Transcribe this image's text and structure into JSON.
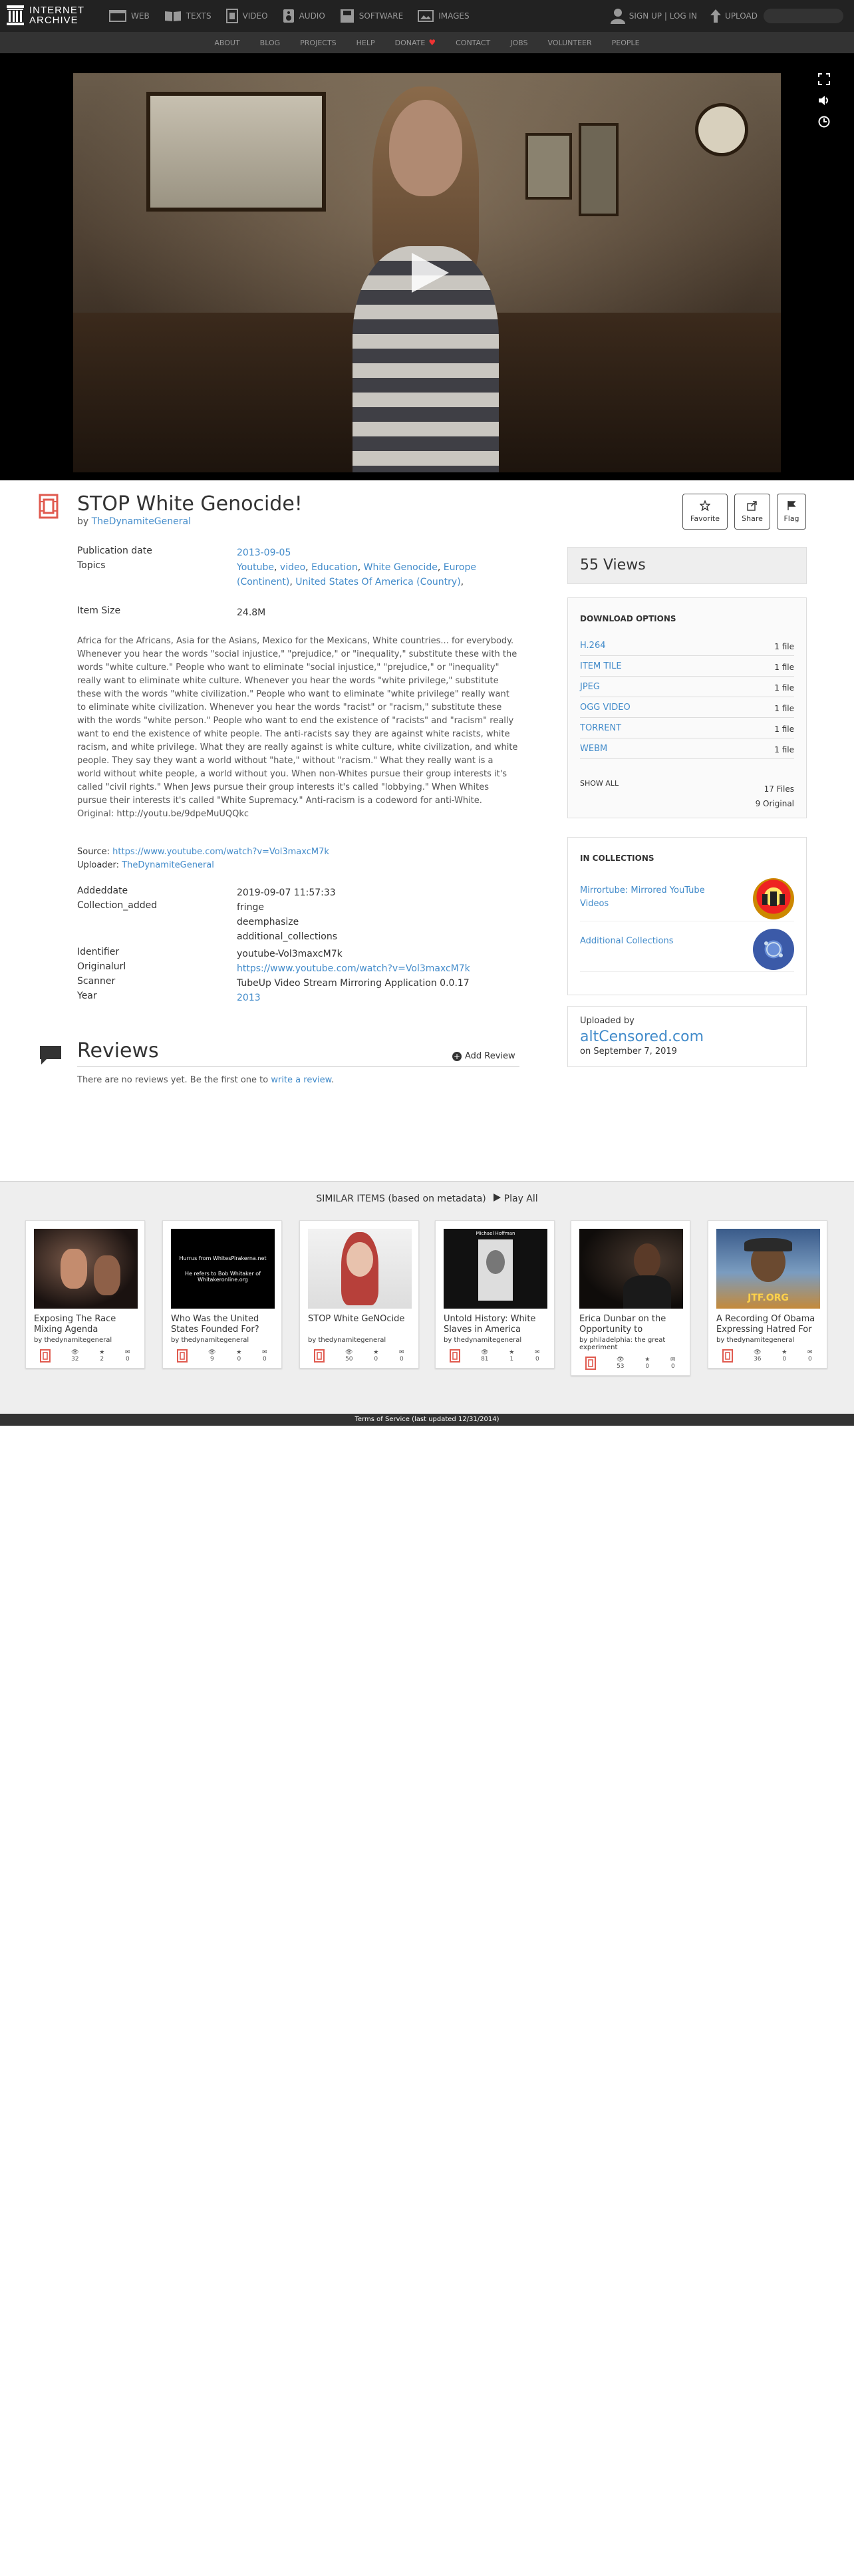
{
  "nav": {
    "logo_line1": "INTERNET",
    "logo_line2": "ARCHIVE",
    "media": [
      {
        "label": "WEB",
        "icon": "web-icon"
      },
      {
        "label": "TEXTS",
        "icon": "texts-icon"
      },
      {
        "label": "VIDEO",
        "icon": "video-icon"
      },
      {
        "label": "AUDIO",
        "icon": "audio-icon"
      },
      {
        "label": "SOFTWARE",
        "icon": "software-icon"
      },
      {
        "label": "IMAGES",
        "icon": "images-icon"
      }
    ],
    "signin": "SIGN UP | LOG IN",
    "upload": "UPLOAD"
  },
  "subnav": {
    "items": [
      "ABOUT",
      "BLOG",
      "PROJECTS",
      "HELP",
      "DONATE",
      "CONTACT",
      "JOBS",
      "VOLUNTEER",
      "PEOPLE"
    ]
  },
  "item": {
    "title": "STOP White Genocide!",
    "by_prefix": "by ",
    "creator": "TheDynamiteGeneral",
    "actions": {
      "favorite": "Favorite",
      "share": "Share",
      "flag": "Flag"
    },
    "pubdate_key": "Publication date",
    "pubdate": "2013-09-05",
    "topics_key": "Topics",
    "topics": [
      "Youtube",
      "video",
      "Education",
      "White Genocide",
      "Europe (Continent)",
      "United States Of America (Country)"
    ],
    "size_key": "Item Size",
    "size": "24.8M",
    "description": "Africa for the Africans, Asia for the Asians, Mexico for the Mexicans, White countries... for everybody. Whenever you hear the words \"social injustice,\" \"prejudice,\" or \"inequality,\" substitute these with the words \"white culture.\" People who want to eliminate \"social injustice,\" \"prejudice,\" or \"inequality\" really want to eliminate white culture. Whenever you hear the words \"white privilege,\" substitute these with the words \"white civilization.\" People who want to eliminate \"white privilege\" really want to eliminate white civilization. Whenever you hear the words \"racist\" or \"racism,\" substitute these with the words \"white person.\" People who want to end the existence of \"racists\" and \"racism\" really want to end the existence of white people. The anti-racists say they are against white racists, white racism, and white privilege. What they are really against is white culture, white civilization, and white people. They say they want a world without \"hate,\" without \"racism.\" What they really want is a world without white people, a world without you. When non-Whites pursue their group interests it's called \"civil rights.\" When Jews pursue their group interests it's called \"lobbying.\" When Whites pursue their interests it's called \"White Supremacy.\" Anti-racism is a codeword for anti-White. Original: http://youtu.be/9dpeMuUQQkc",
    "source_label": "Source: ",
    "source_url": "https://www.youtube.com/watch?v=Vol3maxcM7k",
    "uploader_label": "Uploader: ",
    "uploader": "TheDynamiteGeneral",
    "addeddate_key": "Addeddate",
    "addeddate": "2019-09-07 11:57:33",
    "collection_key": "Collection_added",
    "collections_added": [
      "fringe",
      "deemphasize",
      "additional_collections"
    ],
    "identifier_key": "Identifier",
    "identifier": "youtube-Vol3maxcM7k",
    "originalurl_key": "Originalurl",
    "originalurl": "https://www.youtube.com/watch?v=Vol3maxcM7k",
    "scanner_key": "Scanner",
    "scanner": "TubeUp Video Stream Mirroring Application 0.0.17",
    "year_key": "Year",
    "year": "2013"
  },
  "sidebar": {
    "views": "55 Views",
    "download_heading": "DOWNLOAD OPTIONS",
    "downloads": [
      {
        "format": "H.264",
        "count": "1 file"
      },
      {
        "format": "ITEM TILE",
        "count": "1 file"
      },
      {
        "format": "JPEG",
        "count": "1 file"
      },
      {
        "format": "OGG VIDEO",
        "count": "1 file"
      },
      {
        "format": "TORRENT",
        "count": "1 file"
      },
      {
        "format": "WEBM",
        "count": "1 file"
      }
    ],
    "show_all": "SHOW ALL",
    "files_total": "17 Files",
    "files_original": "9 Original",
    "collections_heading": "IN COLLECTIONS",
    "collections": [
      {
        "name": "Mirrortube: Mirrored YouTube Videos"
      },
      {
        "name": "Additional Collections"
      }
    ],
    "uploaded_by_label": "Uploaded by",
    "uploaded_by": "altCensored.com",
    "uploaded_on": "on September 7, 2019"
  },
  "reviews": {
    "title": "Reviews",
    "add": "Add Review",
    "empty_text": "There are no reviews yet. Be the first one to ",
    "empty_link": "write a review",
    "empty_end": "."
  },
  "similar": {
    "heading": "SIMILAR ITEMS (based on metadata)",
    "play_all": "Play All",
    "items": [
      {
        "title": "Exposing The Race Mixing Agenda",
        "by": "by thedynamitegeneral",
        "views": "32",
        "favs": "2",
        "reviews": "0"
      },
      {
        "title": "Who Was the United States Founded For?",
        "by": "by thedynamitegeneral",
        "views": "9",
        "favs": "0",
        "reviews": "0",
        "thumb_line1": "Hurrus from WhitesPirakerna.net",
        "thumb_line2": "He refers to Bob Whitaker of Whitakeronline.org"
      },
      {
        "title": "STOP White GeNOcide",
        "by": "by thedynamitegeneral",
        "views": "50",
        "favs": "0",
        "reviews": "0"
      },
      {
        "title": "Untold History: White Slaves in America",
        "by": "by thedynamitegeneral",
        "views": "81",
        "favs": "1",
        "reviews": "0",
        "thumb_caption": "Michael Hoffman"
      },
      {
        "title": "Erica Dunbar on the Opportunity to",
        "by": "by philadelphia: the great experiment",
        "views": "53",
        "favs": "0",
        "reviews": "0"
      },
      {
        "title": "A Recording Of Obama Expressing Hatred For",
        "by": "by thedynamitegeneral",
        "views": "36",
        "favs": "0",
        "reviews": "0",
        "thumb_caption": "JTF.ORG"
      }
    ]
  },
  "footer": "Terms of Service (last updated 12/31/2014)",
  "colors": {
    "link": "#428bca",
    "nav_bg": "#222222",
    "subnav_bg": "#333333",
    "movie_icon": "#e05a4f"
  }
}
